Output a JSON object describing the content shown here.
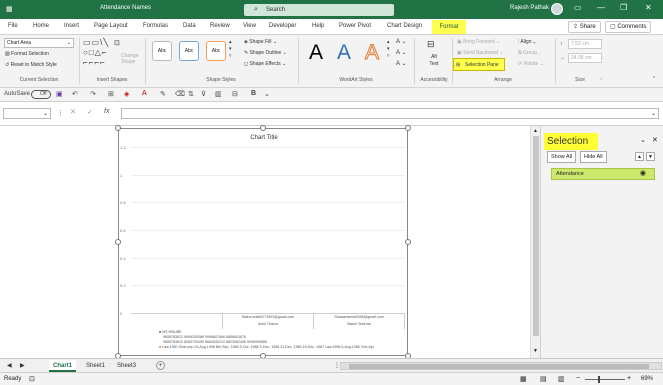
{
  "titlebar": {
    "title": "Attendance Names",
    "search_placeholder": "Search",
    "user": "Rajesh Pathak",
    "minimize": "—",
    "restore": "❐",
    "close": "✕"
  },
  "tabs": [
    "File",
    "Home",
    "Insert",
    "Page Layout",
    "Formulas",
    "Data",
    "Review",
    "View",
    "Developer",
    "Help",
    "Power Pivot",
    "Chart Design"
  ],
  "active_tab": "Format",
  "share": "Share",
  "comments": "Comments",
  "ribbon": {
    "current_selection": {
      "dropdown": "Chart Area",
      "format_selection": "Format Selection",
      "reset_style": "Reset to Match Style",
      "label": "Current Selection"
    },
    "insert_shapes": {
      "change_shape": "Change Shape",
      "label": "Insert Shapes"
    },
    "shape_styles": {
      "sample": "Abc",
      "shape_fill": "Shape Fill",
      "shape_outline": "Shape Outline",
      "shape_effects": "Shape Effects",
      "label": "Shape Styles"
    },
    "wordart": {
      "letter": "A",
      "label": "WordArt Styles"
    },
    "accessibility": {
      "alt_text": "Alt Text",
      "label": "Accessibility"
    },
    "arrange": {
      "bring_forward": "Bring Forward",
      "send_backward": "Send Backward",
      "selection_pane": "Selection Pane",
      "align": "Align",
      "group": "Group",
      "rotate": "Rotate",
      "label": "Arrange"
    },
    "size": {
      "height": "7.52 cm",
      "width": "24.08 cm",
      "label": "Size"
    }
  },
  "qat": {
    "autosave": "AutoSave",
    "toggle": "Off"
  },
  "chart": {
    "title": "Chart Title",
    "legend_line1": "MS MNUBE",
    "legend_line1b": "9655783612 9995330088 9996807666 8866603876",
    "legend_line1c": "9655783612 8283700050 9664532212 8823062456 9936990585",
    "legend_line2": "Law,1960 Shilo,sep 23,Aug,1998 Nih,Sep, 1988 S,Oct, 1988 S,Dec, 1988 31,Dec, 1980 16,Dec, 1987 Law,1998 6,Aug,1986 Chb,Apr"
  },
  "chart_data": {
    "type": "bar",
    "title": "Chart Title",
    "categories": [
      "Ankit Thakur",
      "Manni Sharma"
    ],
    "category_emails": [
      "thakur.ankit9171903@gmail.com",
      "Sharasharma0056@gmail.com"
    ],
    "y_ticks": [
      "1.2",
      "1",
      "0.8",
      "0.6",
      "0.4",
      "0.2",
      "0"
    ],
    "ylim": [
      0,
      1.2
    ],
    "values": [
      0,
      0
    ]
  },
  "selection_pane": {
    "title": "Selection",
    "show_all": "Show All",
    "hide_all": "Hide All",
    "item": "Attendance",
    "close": "✕",
    "options": "⌄"
  },
  "sheet_tabs": [
    "Chart1",
    "Sheet1",
    "Sheet3"
  ],
  "add_sheet": "+",
  "status": {
    "ready": "Ready",
    "zoom": "69%"
  }
}
